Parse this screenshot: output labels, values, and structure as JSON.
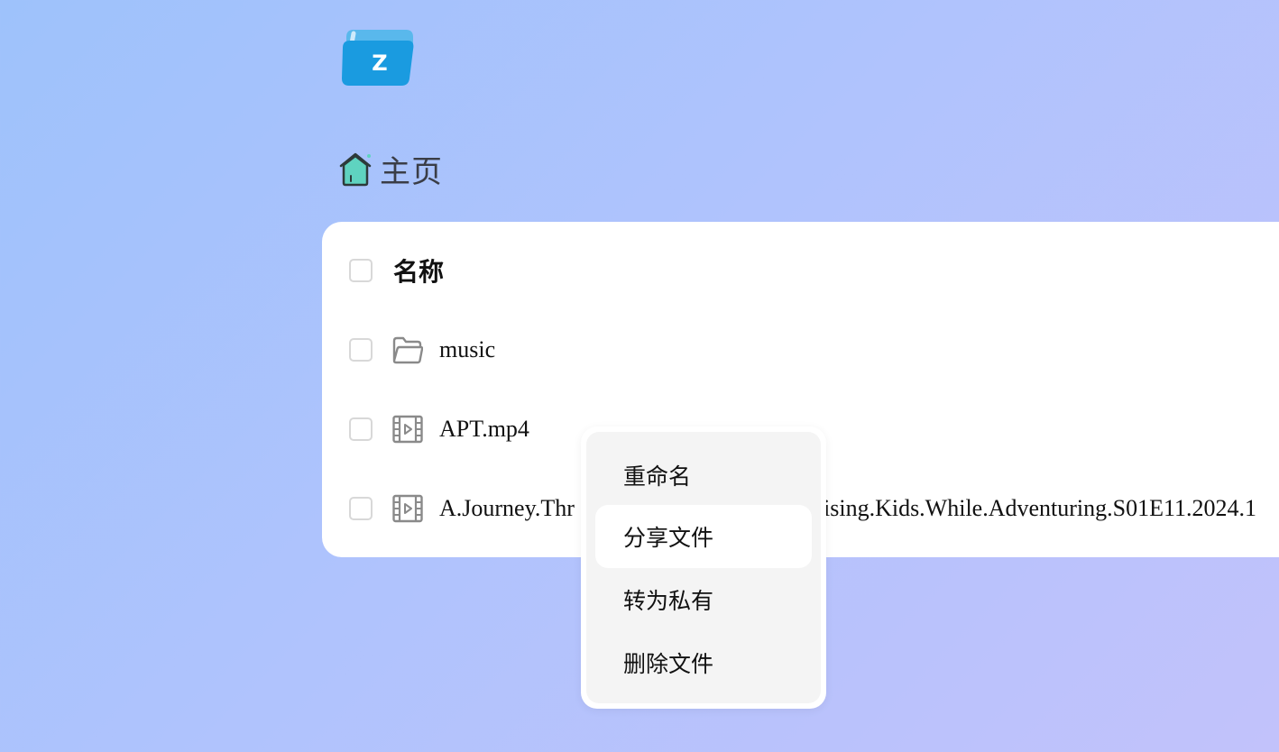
{
  "app": {
    "logo_letter": "Z",
    "brand_color": "#1a9be0"
  },
  "breadcrumb": {
    "icon": "home-icon",
    "label": "主页"
  },
  "file_list": {
    "header": {
      "label": "名称"
    },
    "rows": [
      {
        "name": "music",
        "icon": "folder-icon"
      },
      {
        "name": "APT.mp4",
        "icon": "video-file-icon"
      },
      {
        "name": "A.Journey.Thr",
        "name_tail": "uising.Kids.While.Adventuring.S01E11.2024.1",
        "icon": "video-file-icon"
      }
    ]
  },
  "context_menu": {
    "items": [
      {
        "label": "重命名"
      },
      {
        "label": "分享文件",
        "highlighted": true
      },
      {
        "label": "转为私有"
      },
      {
        "label": "删除文件"
      }
    ]
  }
}
